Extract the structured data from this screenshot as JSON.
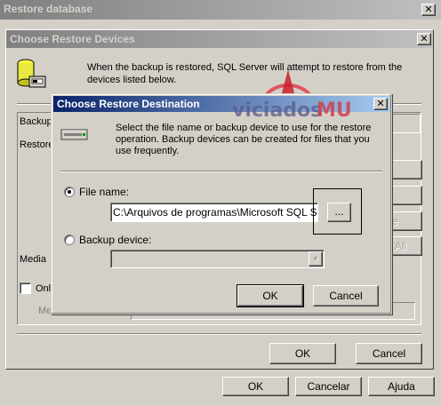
{
  "outer_window": {
    "title": "Restore database",
    "close_glyph": "✕",
    "bg_labels": {
      "backup": "Backup",
      "restore": "Restore",
      "media": "Media",
      "online_partial": "Onl",
      "media_name_partial": "Me"
    },
    "buttons": {
      "ok": "OK",
      "cancel": "Cancelar",
      "help": "Ajuda"
    }
  },
  "devices_dialog": {
    "title": "Choose Restore Devices",
    "close_glyph": "✕",
    "message": "When the backup is restored, SQL Server will attempt to restore from the devices listed below.",
    "bg_button_partials": {
      "remove": "e",
      "all": "All"
    },
    "buttons": {
      "ok": "OK",
      "cancel": "Cancel"
    }
  },
  "destination_dialog": {
    "title": "Choose Restore Destination",
    "close_glyph": "✕",
    "description": "Select the file name or backup device to use for the restore operation.  Backup devices can be created for files that you use frequently.",
    "file_name_label": "File name:",
    "file_name_value": "C:\\Arquivos de programas\\Microsoft SQL Server",
    "browse_label": "...",
    "backup_device_label": "Backup device:",
    "backup_device_value": "",
    "dropdown_arrow": "▼",
    "selected_option": "file_name",
    "buttons": {
      "ok": "OK",
      "cancel": "Cancel"
    }
  },
  "watermark": {
    "text_left": "viciados",
    "text_right": "MU"
  },
  "colors": {
    "active_title": "#0a246a",
    "inactive_title": "#808080",
    "face": "#d4d0c8",
    "watermark_red": "#c8202c"
  },
  "icons": [
    "database-icon",
    "tape-drive-icon",
    "star-emblem-icon"
  ]
}
